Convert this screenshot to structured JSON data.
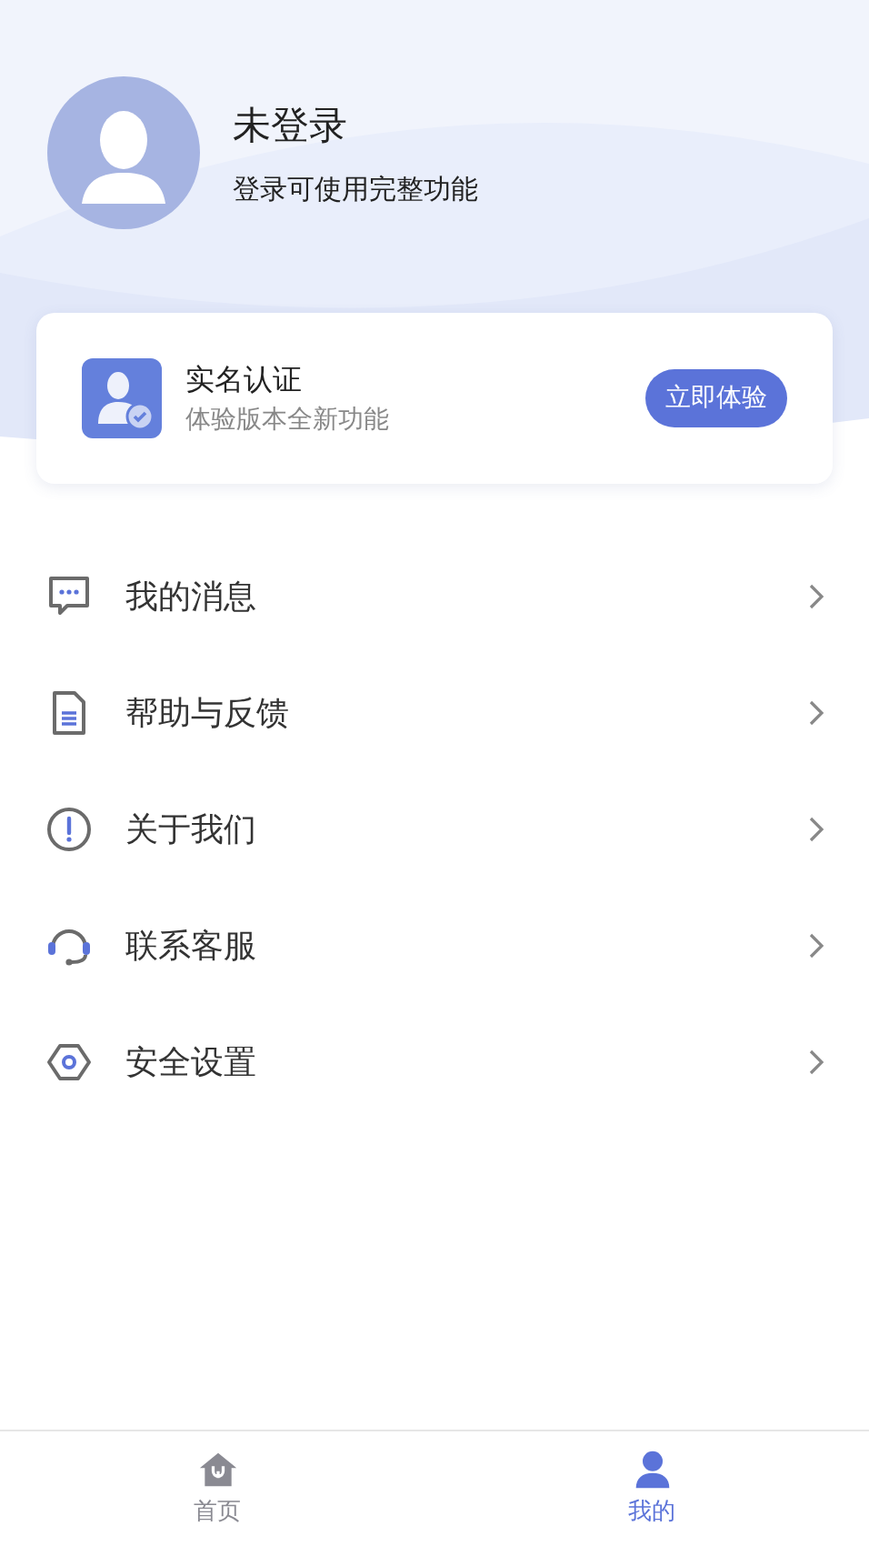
{
  "profile": {
    "name": "未登录",
    "subtitle": "登录可使用完整功能"
  },
  "verify_card": {
    "title": "实名认证",
    "subtitle": "体验版本全新功能",
    "button": "立即体验"
  },
  "menu": [
    {
      "kind": "message",
      "label": "我的消息"
    },
    {
      "kind": "document",
      "label": "帮助与反馈"
    },
    {
      "kind": "info",
      "label": "关于我们"
    },
    {
      "kind": "headset",
      "label": "联系客服"
    },
    {
      "kind": "security",
      "label": "安全设置"
    }
  ],
  "tabs": [
    {
      "kind": "home",
      "label": "首页",
      "selected": false
    },
    {
      "kind": "user",
      "label": "我的",
      "selected": true
    }
  ]
}
